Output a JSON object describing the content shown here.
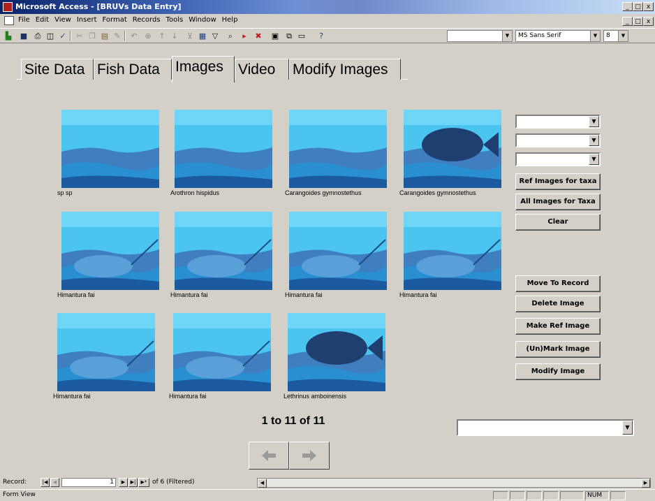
{
  "window": {
    "title": "Microsoft Access - [BRUVs Data Entry]",
    "min_label": "_",
    "max_label": "□",
    "close_label": "x"
  },
  "menu": {
    "items": [
      "File",
      "Edit",
      "View",
      "Insert",
      "Format",
      "Records",
      "Tools",
      "Window",
      "Help"
    ]
  },
  "toolbar": {
    "font_name": "MS Sans Serif",
    "font_size": "8"
  },
  "tabs": [
    "Site Data",
    "Fish Data",
    "Images",
    "Video",
    "Modify Images"
  ],
  "active_tab": "Images",
  "thumbnails": [
    {
      "caption": "sp sp"
    },
    {
      "caption": "Arothron hispidus"
    },
    {
      "caption": "Carangoides gymnostethus"
    },
    {
      "caption": "Carangoides gymnostethus"
    },
    {
      "caption": "Himantura fai"
    },
    {
      "caption": "Himantura fai"
    },
    {
      "caption": "Himantura fai"
    },
    {
      "caption": "Himantura fai"
    },
    {
      "caption": "Himantura fai"
    },
    {
      "caption": "Himantura fai"
    },
    {
      "caption": "Lethrinus amboinensis"
    }
  ],
  "buttons": {
    "ref_images": "Ref Images for taxa",
    "all_images": "All Images for Taxa",
    "clear": "Clear",
    "move_to_record": "Move To Record",
    "delete_image": "Delete Image",
    "make_ref": "Make Ref Image",
    "unmark": "(Un)Mark Image",
    "modify": "Modify Image"
  },
  "counter": "1 to 11 of 11",
  "record_nav": {
    "label": "Record:",
    "current": "1",
    "total": "of  6 (Filtered)"
  },
  "status": {
    "view": "Form View",
    "num": "NUM"
  },
  "colors": {
    "water_light": "#4cc4f0",
    "water_mid": "#2a8fd0",
    "water_dark": "#1c5aa0",
    "seabed": "#3f7fc0"
  }
}
